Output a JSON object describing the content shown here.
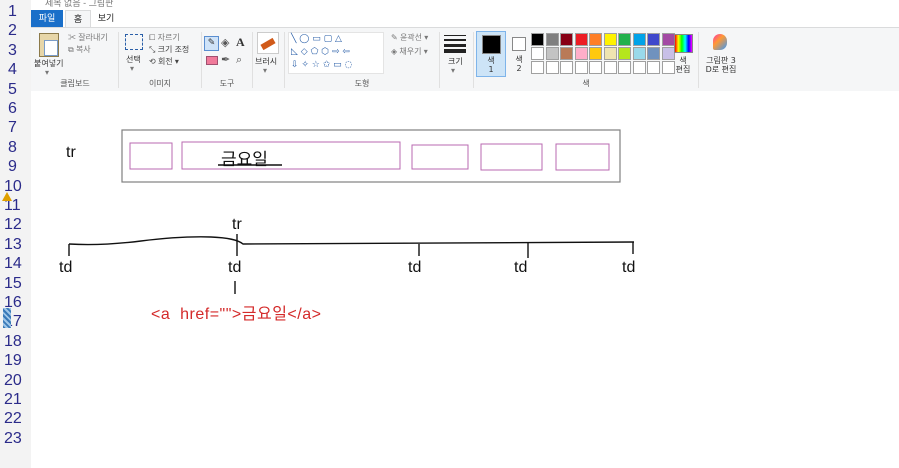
{
  "line_numbers": [
    "1",
    "2",
    "3",
    "4",
    "5",
    "6",
    "7",
    "8",
    "9",
    "10",
    "11",
    "12",
    "13",
    "14",
    "15",
    "16",
    "17",
    "18",
    "19",
    "20",
    "21",
    "22",
    "23"
  ],
  "title": "제목 없음 - 그림판",
  "tabs": {
    "file": "파일",
    "home": "홈",
    "view": "보기"
  },
  "ribbon": {
    "clipboard": {
      "paste": "붙여넣기",
      "cut": "잘라내기",
      "copy": "복사",
      "label": "클립보드"
    },
    "image": {
      "select": "선택",
      "crop": "자르기",
      "resize": "크기 조정",
      "rotate": "회전",
      "label": "이미지"
    },
    "tools": {
      "label": "도구"
    },
    "brushes": {
      "label": "브러시"
    },
    "shapes": {
      "outline": "윤곽선",
      "fill": "채우기",
      "label": "도형"
    },
    "size": {
      "label": "크기"
    },
    "colors": {
      "color1": "색\n1",
      "color2": "색\n2",
      "edit": "색\n편집",
      "paint3d": "그림판 3\nD로 편집",
      "label": "색"
    }
  },
  "palette": {
    "row1": [
      "#000000",
      "#7f7f7f",
      "#880015",
      "#ed1c24",
      "#ff7f27",
      "#fff200",
      "#22b14c",
      "#00a2e8",
      "#3f48cc",
      "#a349a4"
    ],
    "row2": [
      "#ffffff",
      "#c3c3c3",
      "#b97a57",
      "#ffaec9",
      "#ffc90e",
      "#efe4b0",
      "#b5e61d",
      "#99d9ea",
      "#7092be",
      "#c8bfe7"
    ],
    "row3": [
      "#ffffff",
      "#ffffff",
      "#ffffff",
      "#ffffff",
      "#ffffff",
      "#ffffff",
      "#ffffff",
      "#ffffff",
      "#ffffff",
      "#ffffff"
    ]
  },
  "canvas": {
    "tr_label_left": "tr",
    "friday_text": "금요일",
    "tr_label_tree": "tr",
    "td_labels": [
      "td",
      "td",
      "td",
      "td",
      "td"
    ],
    "code": "<a  href=\"\">금요일</a>",
    "code_color": "#d42a2a"
  }
}
